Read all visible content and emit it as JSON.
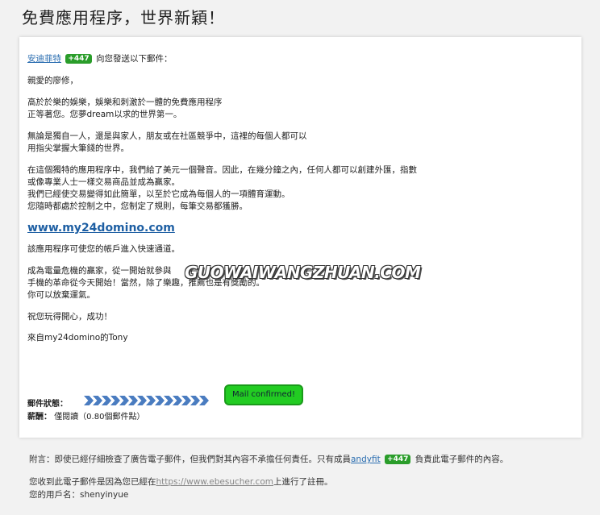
{
  "page": {
    "title": "免費應用程序，世界新穎！"
  },
  "email": {
    "sender_name": "安迪菲特",
    "sender_badge": "+447",
    "sender_suffix": "向您發送以下郵件：",
    "greeting": "親愛的廖修，",
    "para1": [
      "高於於樂的娛樂，娛樂和刺激於一體的免費應用程序",
      "正等著您。您夢dream以求的世界第一。"
    ],
    "para2": [
      "無論是獨自一人，還是與家人，朋友或在社區競爭中，這裡的每個人都可以",
      "用指尖掌握大筆錢的世界。"
    ],
    "para3": [
      "在這個獨特的應用程序中，我們給了美元一個聲音。因此，在幾分鐘之內，任何人都可以創建外匯，指數",
      "或像專業人士一樣交易商品並成為贏家。",
      "我們已經使交易變得如此簡單，以至於它成為每個人的一項體育運動。",
      "您隨時都處於控制之中，您制定了規則，每筆交易都獲勝。"
    ],
    "big_link": "www.my24domino.com",
    "para4": "該應用程序可使您的帳戶進入快速通道。",
    "para5": [
      "成為電量危機的贏家，從一開始就參與",
      "手機的革命從今天開始！當然，除了樂趣，推薦也是有獎勵的。",
      "你可以放棄運氣。"
    ],
    "wish": "祝您玩得開心，成功！",
    "sign": "來自my24domino的Tony",
    "watermark": "GUOWAIWANGZHUAN.COM",
    "status_label": "郵件狀態：",
    "reward_label": "薪酬：",
    "reward_value": "僅閱讀（0.80個郵件點）",
    "confirm_label": "Mail confirmed!"
  },
  "footer": {
    "disclaimer_pre": "附言：即使已經仔細檢查了廣告電子郵件，但我們對其內容不承擔任何責任。只有成員",
    "disclaimer_member": "andyfit",
    "disclaimer_badge": "+447",
    "disclaimer_post": "負責此電子郵件的內容。",
    "reg_pre": "您收到此電子郵件是因為您已經在",
    "reg_link": "https://www.ebesucher.com",
    "reg_post": "上進行了註冊。",
    "username_label": "您的用戶名：",
    "username": "shenyinyue"
  }
}
